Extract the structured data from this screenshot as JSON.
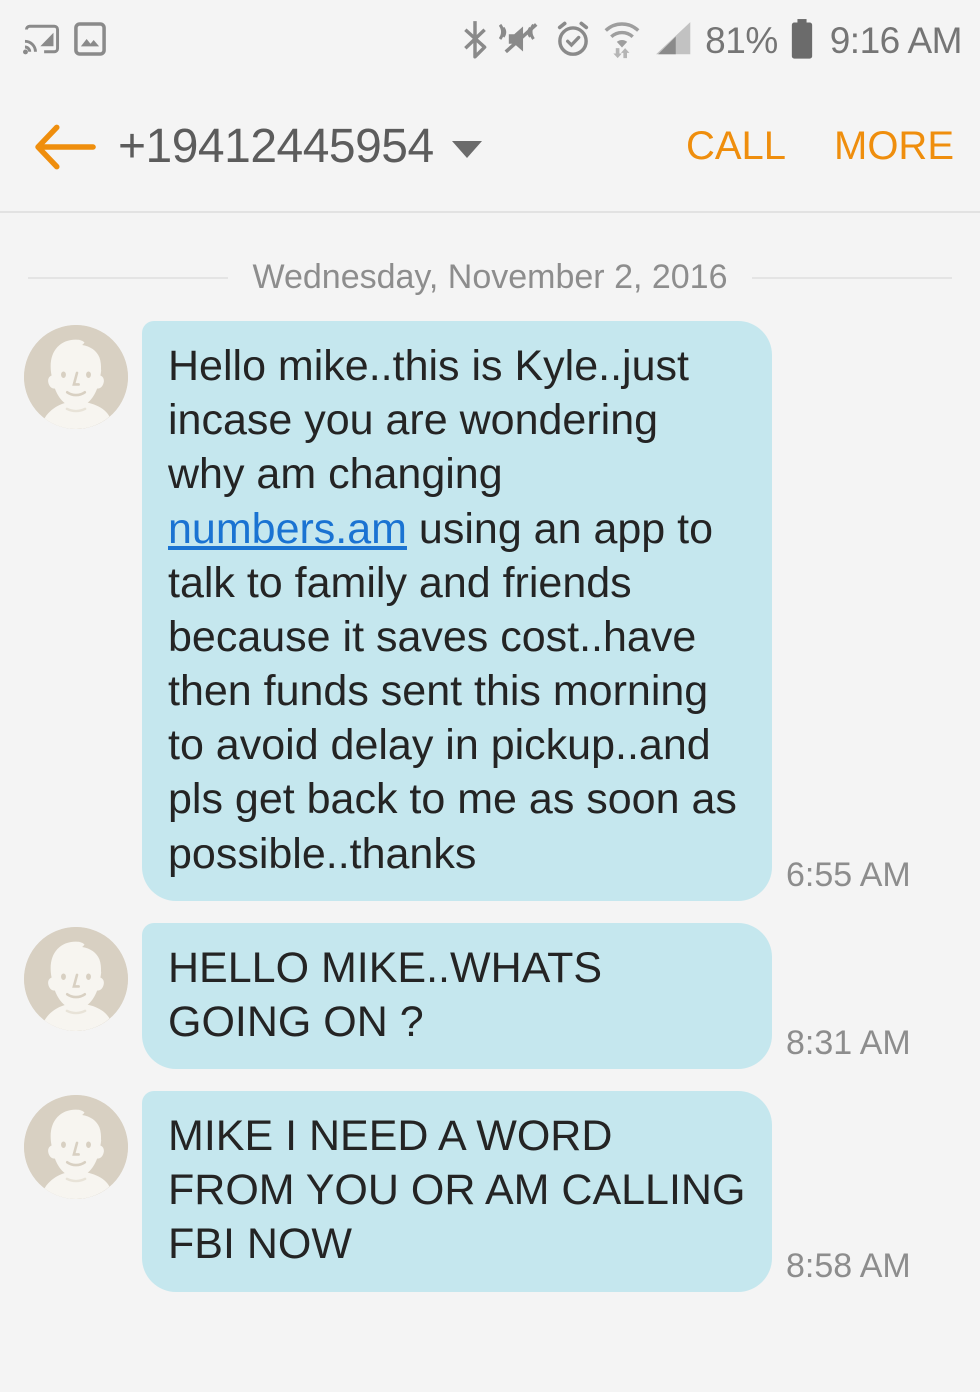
{
  "status_bar": {
    "left_icons": [
      {
        "name": "cast-icon",
        "label": "cast"
      },
      {
        "name": "screenshot-image-icon",
        "label": "screenshot"
      }
    ],
    "right_icons": [
      {
        "name": "bluetooth-icon",
        "label": "bluetooth"
      },
      {
        "name": "mute-vibrate-icon",
        "label": "sound off / vibrate"
      },
      {
        "name": "alarm-icon",
        "label": "alarm"
      },
      {
        "name": "wifi-icon",
        "label": "wifi"
      },
      {
        "name": "cellular-signal-icon",
        "label": "signal"
      }
    ],
    "battery_percent": "81%",
    "clock": "9:16 AM"
  },
  "header": {
    "back_label": "Back",
    "title": "+19412445954",
    "dropdown_label": "Expand recipient",
    "call_label": "CALL",
    "more_label": "MORE"
  },
  "conversation": {
    "date_divider": "Wednesday, November 2, 2016",
    "messages": [
      {
        "sender": "incoming",
        "avatar_name": "contact-avatar",
        "text_before_link": "Hello mike..this is Kyle..just incase you are wondering why am changing ",
        "link_text": "numbers.am",
        "text_after_link": " using an app to talk to family and friends because it saves cost..have then funds sent this morning to avoid delay in pickup..and pls get back to me as soon as possible..thanks",
        "timestamp": "6:55 AM"
      },
      {
        "sender": "incoming",
        "avatar_name": "contact-avatar",
        "text_before_link": "HELLO MIKE..WHATS GOING ON ?",
        "link_text": "",
        "text_after_link": "",
        "timestamp": "8:31 AM"
      },
      {
        "sender": "incoming",
        "avatar_name": "contact-avatar",
        "text_before_link": "MIKE I NEED A WORD FROM YOU OR AM CALLING FBI NOW",
        "link_text": "",
        "text_after_link": "",
        "timestamp": "8:58 AM"
      }
    ]
  },
  "colors": {
    "accent_orange": "#ef8e0d",
    "bubble_incoming": "#c5e7ee",
    "link_blue": "#1a73d2",
    "background": "#f4f4f4",
    "avatar_bg": "#d8d0c2"
  }
}
